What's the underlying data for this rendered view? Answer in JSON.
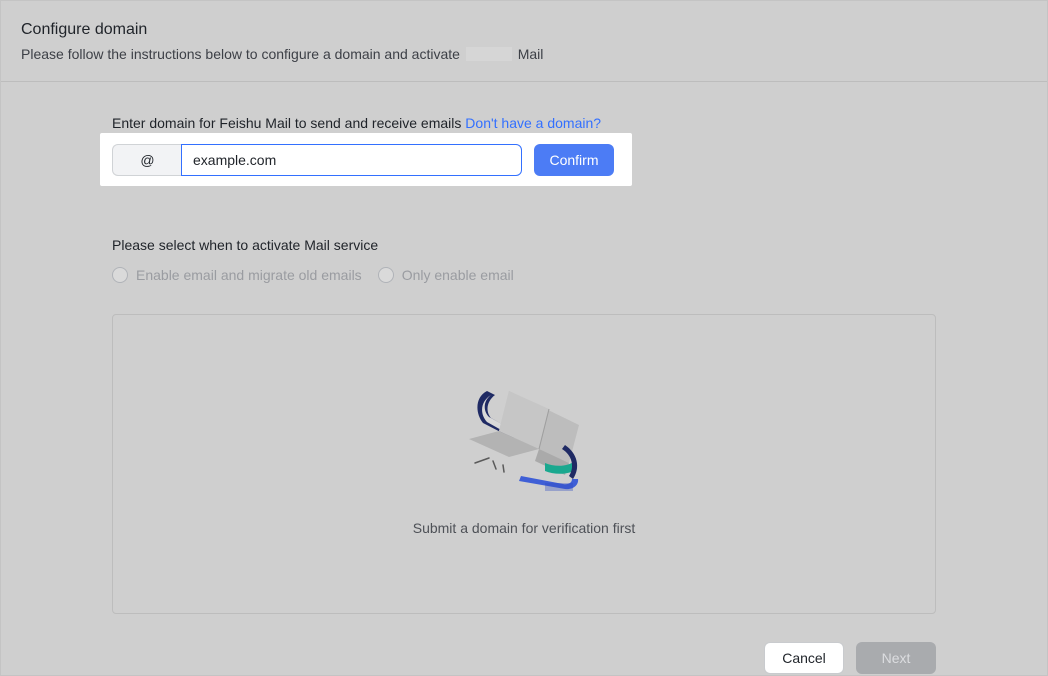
{
  "header": {
    "title": "Configure domain",
    "subtitle_before": "Please follow the instructions below to configure a domain and activate",
    "subtitle_after": "Mail"
  },
  "domain": {
    "label": "Enter domain for Feishu Mail to send and receive emails",
    "link": "Don't have a domain?",
    "at_symbol": "@",
    "input_value": "example.com",
    "confirm_label": "Confirm"
  },
  "activation": {
    "label": "Please select when to activate Mail service",
    "options": [
      {
        "label": "Enable email and migrate old emails",
        "selected": false
      },
      {
        "label": "Only enable email",
        "selected": false
      }
    ]
  },
  "empty_state": {
    "message": "Submit a domain for verification first"
  },
  "footer": {
    "cancel_label": "Cancel",
    "next_label": "Next"
  },
  "colors": {
    "accent": "#4c7cf5",
    "link": "#3370ff",
    "overlay": "#cfcfcf",
    "teal": "#1aa88f",
    "navy": "#1f2a64"
  }
}
